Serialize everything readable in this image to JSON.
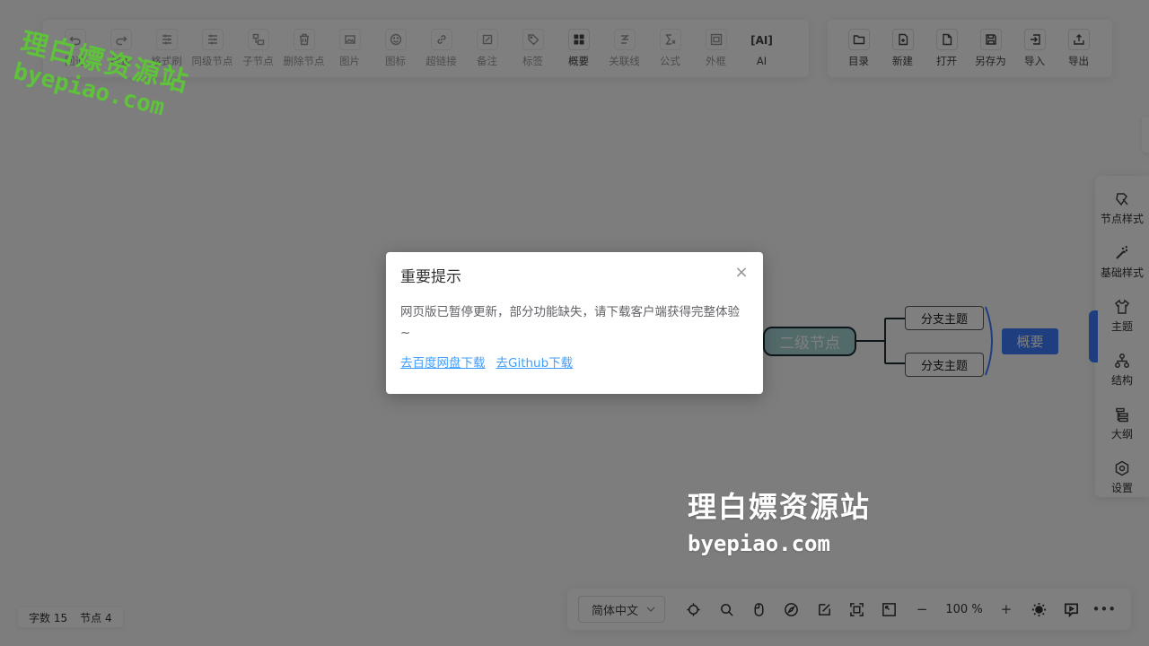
{
  "toolbar_main": {
    "items": [
      {
        "label": "回退",
        "icon": "undo-icon"
      },
      {
        "label": "前进",
        "icon": "redo-icon"
      },
      {
        "label": "格式刷",
        "icon": "format-brush-icon"
      },
      {
        "label": "同级节点",
        "icon": "sibling-node-icon"
      },
      {
        "label": "子节点",
        "icon": "child-node-icon"
      },
      {
        "label": "删除节点",
        "icon": "delete-icon"
      },
      {
        "label": "图片",
        "icon": "image-icon"
      },
      {
        "label": "图标",
        "icon": "emoji-icon"
      },
      {
        "label": "超链接",
        "icon": "link-icon"
      },
      {
        "label": "备注",
        "icon": "note-icon"
      },
      {
        "label": "标签",
        "icon": "tag-icon"
      },
      {
        "label": "概要",
        "icon": "summary-icon"
      },
      {
        "label": "关联线",
        "icon": "association-line-icon"
      },
      {
        "label": "公式",
        "icon": "formula-icon"
      },
      {
        "label": "外框",
        "icon": "outer-frame-icon"
      },
      {
        "label": "AI",
        "icon": "ai-icon"
      }
    ]
  },
  "toolbar_file": {
    "items": [
      {
        "label": "目录",
        "icon": "folder-icon"
      },
      {
        "label": "新建",
        "icon": "new-file-icon"
      },
      {
        "label": "打开",
        "icon": "open-file-icon"
      },
      {
        "label": "另存为",
        "icon": "save-as-icon"
      },
      {
        "label": "导入",
        "icon": "import-icon"
      },
      {
        "label": "导出",
        "icon": "export-icon"
      }
    ]
  },
  "side_panel": {
    "items": [
      {
        "label": "节点样式",
        "icon": "node-style-icon"
      },
      {
        "label": "基础样式",
        "icon": "magic-wand-icon"
      },
      {
        "label": "主题",
        "icon": "shirt-icon"
      },
      {
        "label": "结构",
        "icon": "structure-icon"
      },
      {
        "label": "大纲",
        "icon": "outline-icon"
      },
      {
        "label": "设置",
        "icon": "settings-icon"
      }
    ]
  },
  "mindmap": {
    "second_node": "二级节点",
    "branch_1": "分支主题",
    "branch_2": "分支主题",
    "summary": "概要"
  },
  "stats": {
    "word_count_label": "字数",
    "word_count": "15",
    "node_count_label": "节点",
    "node_count": "4"
  },
  "bottom_bar": {
    "language": "简体中文",
    "zoom_value": "100",
    "zoom_unit": "%",
    "zoom_out": "−",
    "zoom_in": "+",
    "more": "•••"
  },
  "dialog": {
    "title": "重要提示",
    "close": "×",
    "message": "网页版已暂停更新，部分功能缺失，请下载客户端获得完整体验~",
    "link_baidu": "去百度网盘下载",
    "link_github": "去Github下载"
  },
  "watermark": {
    "top_line1": "理白嫖资源站",
    "top_line2": "byepiao.com",
    "bottom_line1": "理白嫖资源站",
    "bottom_line2": "byepiao.com"
  },
  "colors": {
    "accent": "#3c7cff",
    "link": "#409eff",
    "second_node_fill": "#a7d4d7",
    "watermark_green": "#5ec33a"
  }
}
